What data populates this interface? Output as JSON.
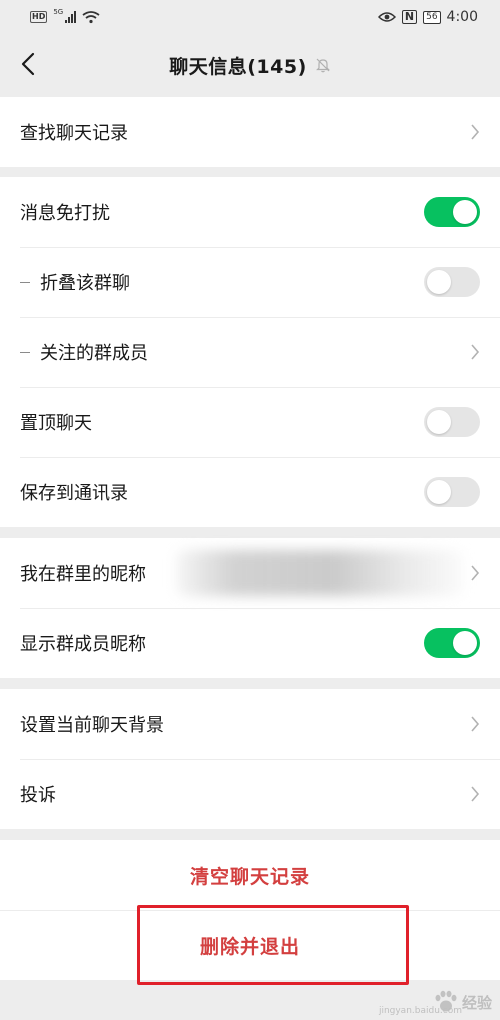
{
  "status_bar": {
    "hd": "HD",
    "network": "5G",
    "battery": "56",
    "time": "4:00"
  },
  "header": {
    "title": "聊天信息(145)"
  },
  "sections": {
    "search": {
      "label": "查找聊天记录"
    },
    "dnd": {
      "label": "消息免打扰",
      "on": true
    },
    "fold": {
      "label": "折叠该群聊",
      "on": false
    },
    "followed": {
      "label": "关注的群成员"
    },
    "pin": {
      "label": "置顶聊天",
      "on": false
    },
    "save_contacts": {
      "label": "保存到通讯录",
      "on": false
    },
    "nickname": {
      "label": "我在群里的昵称"
    },
    "show_nick": {
      "label": "显示群成员昵称",
      "on": true
    },
    "background": {
      "label": "设置当前聊天背景"
    },
    "complain": {
      "label": "投诉"
    }
  },
  "actions": {
    "clear": "清空聊天记录",
    "delete_exit": "删除并退出"
  },
  "colors": {
    "accent_green": "#07c160",
    "danger_red": "#d33f3f",
    "highlight_red": "#e0202a",
    "page_bg": "#ededed"
  },
  "watermark": {
    "text": "经验",
    "sub": "jingyan.baidu.com"
  }
}
